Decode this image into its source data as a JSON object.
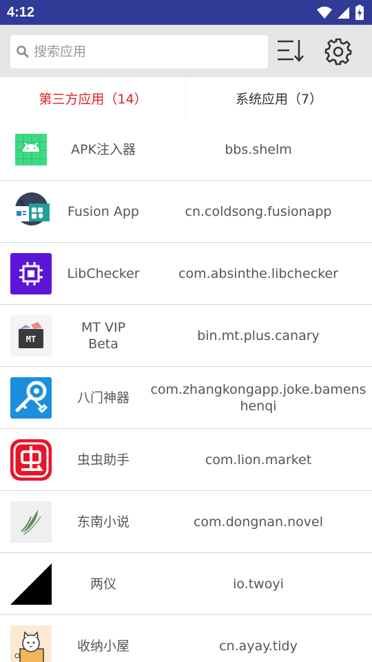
{
  "status_bar": {
    "time": "4:12"
  },
  "search": {
    "placeholder": "搜索应用",
    "value": ""
  },
  "tabs": [
    {
      "label": "第三方应用（14）",
      "active": true
    },
    {
      "label": "系统应用（7）",
      "active": false
    }
  ],
  "apps": [
    {
      "name": "APK注入器",
      "package": "bbs.shelm",
      "icon": "android-icon"
    },
    {
      "name": "Fusion App",
      "package": "cn.coldsong.fusionapp",
      "icon": "fusion-app-icon"
    },
    {
      "name": "LibChecker",
      "package": "com.absinthe.libchecker",
      "icon": "chip-icon"
    },
    {
      "name": "MT VIP Beta",
      "package": "bin.mt.plus.canary",
      "icon": "mt-box-icon"
    },
    {
      "name": "八门神器",
      "package": "com.zhangkongapp.joke.bamenshenqi",
      "icon": "key-wrench-icon"
    },
    {
      "name": "虫虫助手",
      "package": "com.lion.market",
      "icon": "chongchong-icon"
    },
    {
      "name": "东南小说",
      "package": "com.dongnan.novel",
      "icon": "leaf-icon"
    },
    {
      "name": "两仪",
      "package": "io.twoyi",
      "icon": "triangle-icon"
    },
    {
      "name": "收纳小屋",
      "package": "cn.ayay.tidy",
      "icon": "cat-box-icon"
    }
  ],
  "colors": {
    "status_bar": "#2f3b97",
    "toolbar": "#e6e6e6",
    "active_tab": "#e02020"
  }
}
